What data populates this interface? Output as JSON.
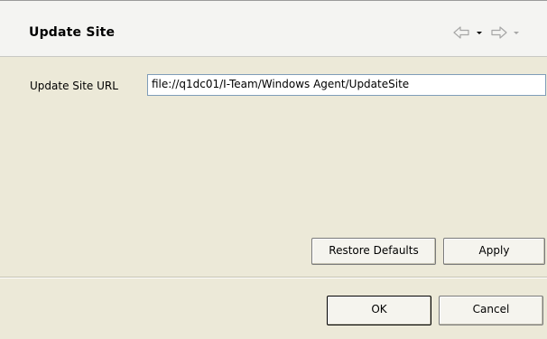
{
  "page": {
    "title": "Update Site"
  },
  "nav": {
    "back_icon": "back-arrow-icon",
    "back_menu_icon": "dropdown-icon",
    "forward_icon": "forward-arrow-icon",
    "forward_menu_icon": "dropdown-icon"
  },
  "form": {
    "url_label": "Update Site URL",
    "url_value": "file://q1dc01/I-Team/Windows Agent/UpdateSite"
  },
  "buttons": {
    "restore_defaults": "Restore Defaults",
    "apply": "Apply",
    "ok": "OK",
    "cancel": "Cancel"
  },
  "colors": {
    "title_bg": "#f4f4f2",
    "content_bg": "#ece9d8",
    "input_border": "#7f9db9"
  }
}
